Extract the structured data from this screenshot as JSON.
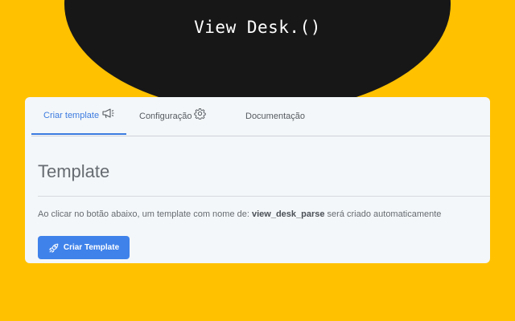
{
  "brand": {
    "title": "View Desk.()"
  },
  "tabs": [
    {
      "label": "Criar template",
      "icon": "megaphone-icon",
      "active": true
    },
    {
      "label": "Configuração",
      "icon": "gear-icon",
      "active": false
    },
    {
      "label": "Documentação",
      "icon": "",
      "active": false
    }
  ],
  "main": {
    "heading": "Template",
    "description_prefix": "Ao clicar no botão abaixo, um template com nome de: ",
    "template_name": "view_desk_parse",
    "description_suffix": " será criado automaticamente",
    "button_label": "Criar Template",
    "button_icon": "rocket-icon"
  },
  "colors": {
    "background": "#FFC100",
    "header_blob": "#171717",
    "card": "#F4F7F9",
    "accent": "#3F82EA"
  }
}
